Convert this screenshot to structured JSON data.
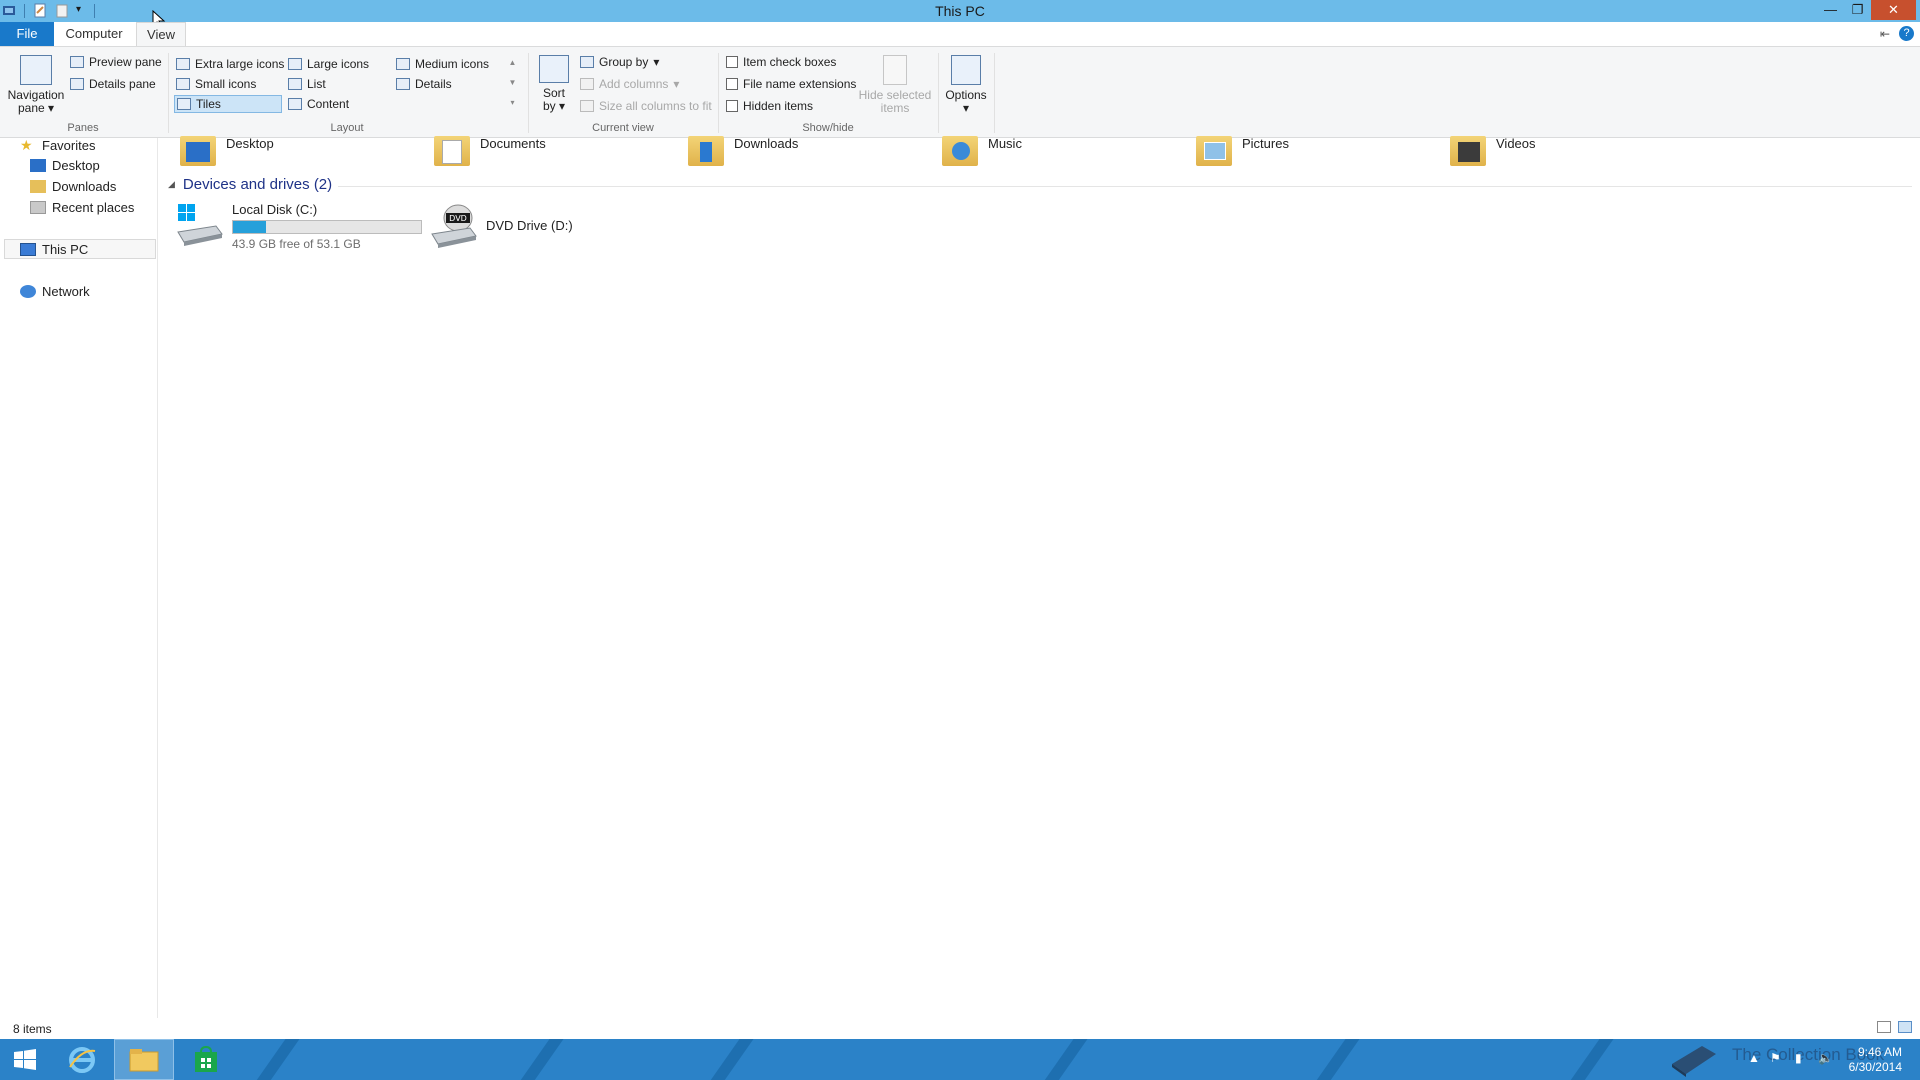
{
  "window": {
    "title": "This PC"
  },
  "tabs": [
    {
      "label": "File"
    },
    {
      "label": "Computer"
    },
    {
      "label": "View"
    }
  ],
  "ribbon": {
    "panes": {
      "navigation_pane": "Navigation pane",
      "preview_pane": "Preview pane",
      "details_pane": "Details pane",
      "group_label": "Panes"
    },
    "layout": {
      "items": [
        "Extra large icons",
        "Large icons",
        "Medium icons",
        "Small icons",
        "List",
        "Details",
        "Tiles",
        "Content"
      ],
      "selected": "Tiles",
      "group_label": "Layout"
    },
    "current_view": {
      "sort_by": "Sort by",
      "group_by": "Group by",
      "add_columns": "Add columns",
      "size_columns": "Size all columns to fit",
      "group_label": "Current view"
    },
    "show_hide": {
      "item_check_boxes": "Item check boxes",
      "file_name_extensions": "File name extensions",
      "hidden_items": "Hidden items",
      "hide_selected": "Hide selected items",
      "group_label": "Show/hide"
    },
    "options": "Options"
  },
  "nav": {
    "favorites": "Favorites",
    "desktop": "Desktop",
    "downloads": "Downloads",
    "recent": "Recent places",
    "this_pc": "This PC",
    "network": "Network"
  },
  "folders": [
    "Desktop",
    "Documents",
    "Downloads",
    "Music",
    "Pictures",
    "Videos"
  ],
  "devices": {
    "heading": "Devices and drives (2)",
    "local_disk": {
      "name": "Local Disk (C:)",
      "free": "43.9 GB free of 53.1 GB",
      "used_fraction": 0.173
    },
    "dvd": {
      "name": "DVD Drive (D:)",
      "badge": "DVD"
    }
  },
  "status": {
    "count": "8 items"
  },
  "taskbar": {
    "time": "9:46 AM",
    "date": "6/30/2014",
    "watermark": "The Collection Book"
  },
  "colors": {
    "titlebar": "#6cbbe9",
    "file_tab": "#1979ca",
    "taskbar": "#2b82c8",
    "drive_bar": "#26a0da"
  }
}
